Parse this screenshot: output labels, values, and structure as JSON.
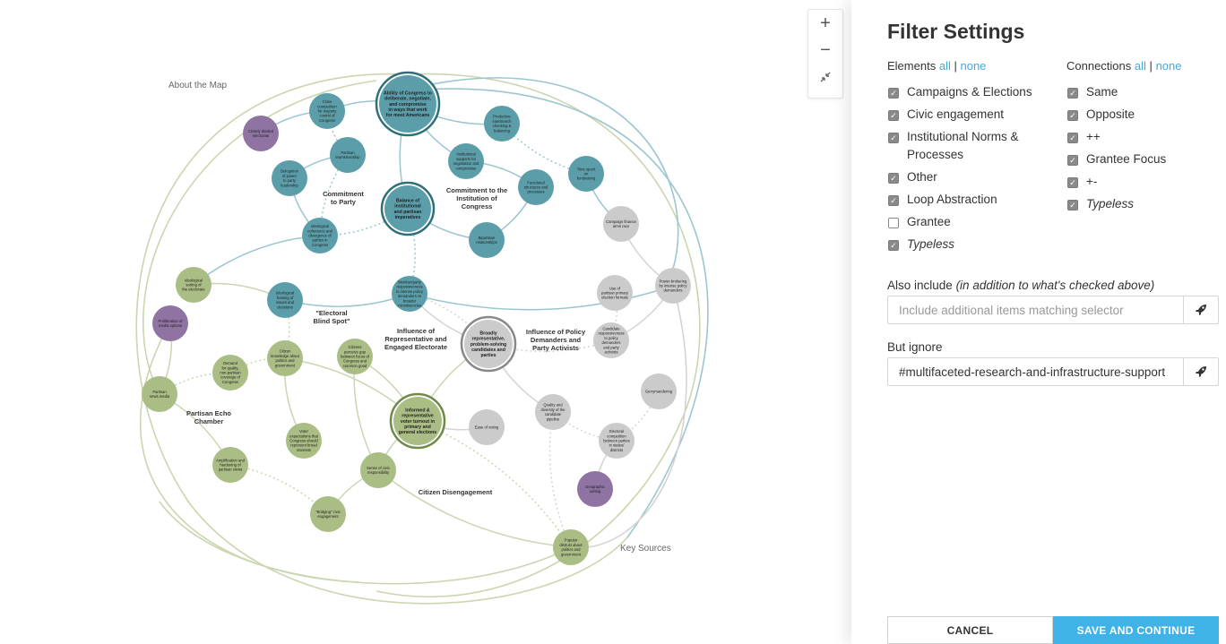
{
  "map": {
    "about_label": "About the Map",
    "key_sources_label": "Key Sources",
    "zoom": {
      "in": "+",
      "out": "−"
    },
    "colors": {
      "teal": "#5b9eaa",
      "teal_dark": "#2f6f78",
      "green": "#a9bd84",
      "green_dark": "#6f8a47",
      "purple": "#8f73a3",
      "gray": "#cbcbcb",
      "gray_dark": "#888888",
      "link_teal": "#9cc6cf",
      "link_green": "#c9d6b0",
      "link_gray": "#d4d4d4"
    },
    "clusters": [
      {
        "id": "c-party",
        "lines": [
          "Commitment",
          "to Party"
        ]
      },
      {
        "id": "c-institution",
        "lines": [
          "Commitment to the",
          "Institution of",
          "Congress"
        ]
      },
      {
        "id": "c-blindspot",
        "lines": [
          "\"Electoral",
          "Blind Spot\""
        ]
      },
      {
        "id": "c-representative",
        "lines": [
          "Influence of",
          "Representative and",
          "Engaged Electorate"
        ]
      },
      {
        "id": "c-demanders",
        "lines": [
          "Influence of Policy",
          "Demanders and",
          "Party Activists"
        ]
      },
      {
        "id": "c-echo",
        "lines": [
          "Partisan Echo",
          "Chamber"
        ]
      },
      {
        "id": "c-disengagement",
        "lines": [
          "Citizen Disengagement"
        ]
      }
    ],
    "nodes": [
      {
        "id": "n-congress",
        "type": "teal",
        "key": true,
        "lines": [
          "Ability of Congress to",
          "deliberate, negotiate,",
          "and compromise",
          "in ways that work",
          "for most Americans"
        ]
      },
      {
        "id": "n-close",
        "type": "teal",
        "lines": [
          "Close",
          "competition",
          "for majority",
          "control of",
          "Congress"
        ]
      },
      {
        "id": "n-divided",
        "type": "purple",
        "lines": [
          "Closely divided",
          "electorate"
        ]
      },
      {
        "id": "n-partisan-lead",
        "type": "teal",
        "lines": [
          "Partisan",
          "teamsmanship"
        ]
      },
      {
        "id": "n-delegation",
        "type": "teal",
        "lines": [
          "Delegation",
          "of power",
          "to party",
          "leadership"
        ]
      },
      {
        "id": "n-ideological-coh",
        "type": "teal",
        "lines": [
          "Ideological",
          "coherence and",
          "divergence of",
          "parties in",
          "Congress"
        ]
      },
      {
        "id": "n-balance",
        "type": "teal",
        "key": true,
        "lines": [
          "Balance of",
          "institutional",
          "and partisan",
          "imperatives"
        ]
      },
      {
        "id": "n-institutional",
        "type": "teal",
        "lines": [
          "Institutional",
          "supports for",
          "negotiation and",
          "compromise"
        ]
      },
      {
        "id": "n-productive",
        "type": "teal",
        "lines": [
          "Productive",
          "interbranch",
          "checking &",
          "balancing"
        ]
      },
      {
        "id": "n-functional",
        "type": "teal",
        "lines": [
          "Functional",
          "structures and",
          "processes"
        ]
      },
      {
        "id": "n-bipartisan",
        "type": "teal",
        "lines": [
          "Bipartisan",
          "relationships"
        ]
      },
      {
        "id": "n-time",
        "type": "teal",
        "lines": [
          "Time spent",
          "on",
          "fundraising"
        ]
      },
      {
        "id": "n-campaign",
        "type": "gray",
        "lines": [
          "Campaign finance",
          "arms race"
        ]
      },
      {
        "id": "n-power",
        "type": "gray",
        "lines": [
          "Power-brokering",
          "by intense policy",
          "demanders"
        ]
      },
      {
        "id": "n-members",
        "type": "teal",
        "lines": [
          "Member/party",
          "responsiveness",
          "to intense policy",
          "demanders vs",
          "broader",
          "constituencies"
        ]
      },
      {
        "id": "n-ideo-framing",
        "type": "teal",
        "lines": [
          "Ideological",
          "framing of",
          "issues and",
          "decisions"
        ]
      },
      {
        "id": "n-ideo-sorting",
        "type": "green",
        "lines": [
          "Ideological",
          "sorting of",
          "the electorate"
        ]
      },
      {
        "id": "n-prolif",
        "type": "purple",
        "lines": [
          "Proliferation of",
          "media options"
        ]
      },
      {
        "id": "n-broadly",
        "type": "gray",
        "key": true,
        "lines": [
          "Broadly",
          "representative,",
          "problem-solving",
          "candidates and",
          "parties"
        ]
      },
      {
        "id": "n-primary",
        "type": "gray",
        "lines": [
          "Use of",
          "partisan primary",
          "election formats"
        ]
      },
      {
        "id": "n-candidate",
        "type": "gray",
        "lines": [
          "Candidate",
          "responsiveness",
          "to policy",
          "demanders",
          "and party",
          "activists"
        ]
      },
      {
        "id": "n-citizen-know",
        "type": "green",
        "lines": [
          "Citizen",
          "knowledge about",
          "politics and",
          "government"
        ]
      },
      {
        "id": "n-citizens-gap",
        "type": "green",
        "lines": [
          "Citizens",
          "perceive gap",
          "between focus of",
          "Congress and",
          "common good"
        ]
      },
      {
        "id": "n-demand",
        "type": "green",
        "lines": [
          "Demand",
          "for quality,",
          "non-partisan",
          "coverage of",
          "Congress"
        ]
      },
      {
        "id": "n-partisan-news",
        "type": "green",
        "lines": [
          "Partisan",
          "news media"
        ]
      },
      {
        "id": "n-informed",
        "type": "green",
        "key": true,
        "lines": [
          "Informed &",
          "representative",
          "voter turnout in",
          "primary and",
          "general elections"
        ]
      },
      {
        "id": "n-ease",
        "type": "gray",
        "lines": [
          "Ease of voting"
        ]
      },
      {
        "id": "n-quality",
        "type": "gray",
        "lines": [
          "Quality and",
          "diversity of the",
          "candidate",
          "pipeline"
        ]
      },
      {
        "id": "n-gerry",
        "type": "gray",
        "lines": [
          "Gerrymandering"
        ]
      },
      {
        "id": "n-electoral-comp",
        "type": "gray",
        "lines": [
          "Electoral",
          "competition",
          "between parties",
          "in states/",
          "districts"
        ]
      },
      {
        "id": "n-geo",
        "type": "purple",
        "lines": [
          "Geographic",
          "sorting"
        ]
      },
      {
        "id": "n-voter-exp",
        "type": "green",
        "lines": [
          "Voter",
          "expectations that",
          "Congress should",
          "represent broad",
          "interests"
        ]
      },
      {
        "id": "n-amplification",
        "type": "green",
        "lines": [
          "Amplification and",
          "hardening of",
          "partisan views"
        ]
      },
      {
        "id": "n-sense",
        "type": "green",
        "lines": [
          "Sense of civic",
          "responsibility"
        ]
      },
      {
        "id": "n-bridging",
        "type": "green",
        "lines": [
          "\"Bridging\" civic",
          "engagement"
        ]
      },
      {
        "id": "n-distrust",
        "type": "green",
        "lines": [
          "Popular",
          "distrust about",
          "politics and",
          "government"
        ]
      }
    ]
  },
  "panel": {
    "title": "Filter Settings",
    "elements": {
      "heading": "Elements",
      "all": "all",
      "sep": "|",
      "none": "none",
      "items": [
        {
          "label": "Campaigns & Elections",
          "checked": true,
          "italic": false
        },
        {
          "label": "Civic engagement",
          "checked": true,
          "italic": false
        },
        {
          "label": "Institutional Norms & Processes",
          "checked": true,
          "italic": false
        },
        {
          "label": "Other",
          "checked": true,
          "italic": false
        },
        {
          "label": "Loop Abstraction",
          "checked": true,
          "italic": false
        },
        {
          "label": "Grantee",
          "checked": false,
          "italic": false
        },
        {
          "label": "Typeless",
          "checked": true,
          "italic": true
        }
      ]
    },
    "connections": {
      "heading": "Connections",
      "all": "all",
      "sep": "|",
      "none": "none",
      "items": [
        {
          "label": "Same",
          "checked": true,
          "italic": false
        },
        {
          "label": "Opposite",
          "checked": true,
          "italic": false
        },
        {
          "label": "++",
          "checked": true,
          "italic": false
        },
        {
          "label": "Grantee Focus",
          "checked": true,
          "italic": false
        },
        {
          "label": "+-",
          "checked": true,
          "italic": false
        },
        {
          "label": "Typeless",
          "checked": true,
          "italic": true
        }
      ]
    },
    "also_include": {
      "label": "Also include",
      "label_note": "(in addition to what's checked above)",
      "value": "",
      "placeholder": "Include additional items matching selector"
    },
    "but_ignore": {
      "label": "But ignore",
      "value": "#multifaceted-research-and-infrastructure-support",
      "placeholder": ""
    },
    "cancel_label": "CANCEL",
    "save_label": "SAVE AND CONTINUE",
    "accent_color": "#3fb2e8"
  }
}
